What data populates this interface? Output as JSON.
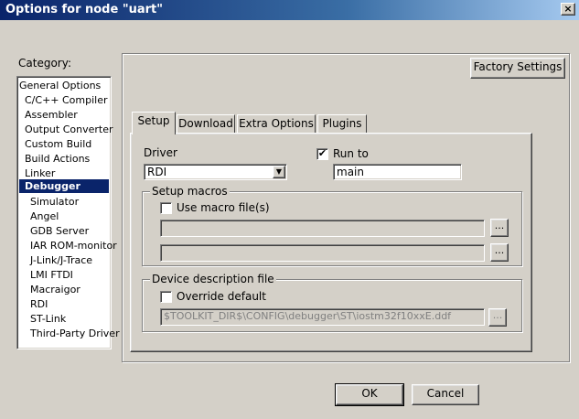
{
  "window": {
    "title": "Options for node \"uart\"",
    "close_glyph": "×"
  },
  "category": {
    "label": "Category:",
    "items": [
      "General Options",
      "C/C++ Compiler",
      "Assembler",
      "Output Converter",
      "Custom Build",
      "Build Actions",
      "Linker",
      "Debugger",
      "Simulator",
      "Angel",
      "GDB Server",
      "IAR ROM-monitor",
      "J-Link/J-Trace",
      "LMI FTDI",
      "Macraigor",
      "RDI",
      "ST-Link",
      "Third-Party Driver"
    ],
    "selected": "Debugger"
  },
  "factory_settings_label": "Factory Settings",
  "tabs": [
    {
      "label": "Setup",
      "active": true
    },
    {
      "label": "Download",
      "active": false
    },
    {
      "label": "Extra Options",
      "active": false
    },
    {
      "label": "Plugins",
      "active": false
    }
  ],
  "setup": {
    "driver_label": "Driver",
    "driver_value": "RDI",
    "run_to_label": "Run to",
    "run_to_checked": true,
    "run_to_value": "main",
    "setup_macros": {
      "title": "Setup macros",
      "use_macro_label": "Use macro file(s)",
      "use_macro_checked": false,
      "browse_label": "..."
    },
    "device_description": {
      "title": "Device description file",
      "override_label": "Override default",
      "override_checked": false,
      "file_path": "$TOOLKIT_DIR$\\CONFIG\\debugger\\ST\\iostm32f10xxE.ddf",
      "browse_label": "..."
    }
  },
  "footer": {
    "ok_label": "OK",
    "cancel_label": "Cancel"
  }
}
